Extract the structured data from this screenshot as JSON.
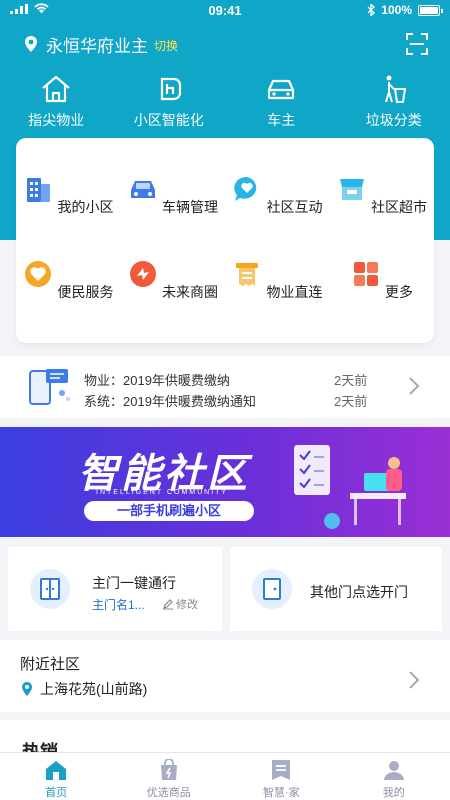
{
  "status_bar": {
    "time": "09:41",
    "battery": "100%"
  },
  "location": {
    "name": "永恒华府业主",
    "switch_label": "切换"
  },
  "quick_nav": [
    {
      "label": "指尖物业",
      "icon": "home-icon"
    },
    {
      "label": "小区智能化",
      "icon": "smart-community-icon"
    },
    {
      "label": "车主",
      "icon": "car-icon"
    },
    {
      "label": "垃圾分类",
      "icon": "trash-sorting-icon"
    }
  ],
  "services": [
    {
      "label": "我的小区",
      "icon": "building-icon",
      "color": "#3d7be6"
    },
    {
      "label": "车辆管理",
      "icon": "car-icon",
      "color": "#3d7be6"
    },
    {
      "label": "社区互动",
      "icon": "chat-icon",
      "color": "#29b4e6"
    },
    {
      "label": "社区超市",
      "icon": "store-icon",
      "color": "#29b4e6"
    },
    {
      "label": "便民服务",
      "icon": "heart-icon",
      "color": "#f5a623"
    },
    {
      "label": "未来商圈",
      "icon": "shopping-circle-icon",
      "color": "#f05a3a"
    },
    {
      "label": "物业直连",
      "icon": "receipt-icon",
      "color": "#f5a623"
    },
    {
      "label": "更多",
      "icon": "grid-icon",
      "color": "#f05a3a"
    }
  ],
  "notices": [
    {
      "prefix": "物业：",
      "text": "2019年供暖费缴纳",
      "time": "2天前"
    },
    {
      "prefix": "系统：",
      "text": "2019年供暖费缴纳通知",
      "time": "2天前"
    }
  ],
  "banner": {
    "title": "智能社区",
    "subtitle_en": "INTELLIGENT COMMUNITY",
    "tagline": "一部手机刷遍小区"
  },
  "doors": {
    "main": {
      "title": "主门一键通行",
      "name": "主门名1...",
      "edit": "修改"
    },
    "other": {
      "title": "其他门点选开门"
    }
  },
  "nearby": {
    "title": "附近社区",
    "location": "上海花苑(山前路)"
  },
  "hot": {
    "title": "热销"
  },
  "tabs": [
    {
      "label": "首页",
      "active": true
    },
    {
      "label": "优选商品",
      "active": false
    },
    {
      "label": "智慧·家",
      "active": false
    },
    {
      "label": "我的",
      "active": false
    }
  ],
  "colors": {
    "header": "#0fa6c8",
    "accent": "#1aa0c4",
    "switch": "#ffe14d"
  }
}
